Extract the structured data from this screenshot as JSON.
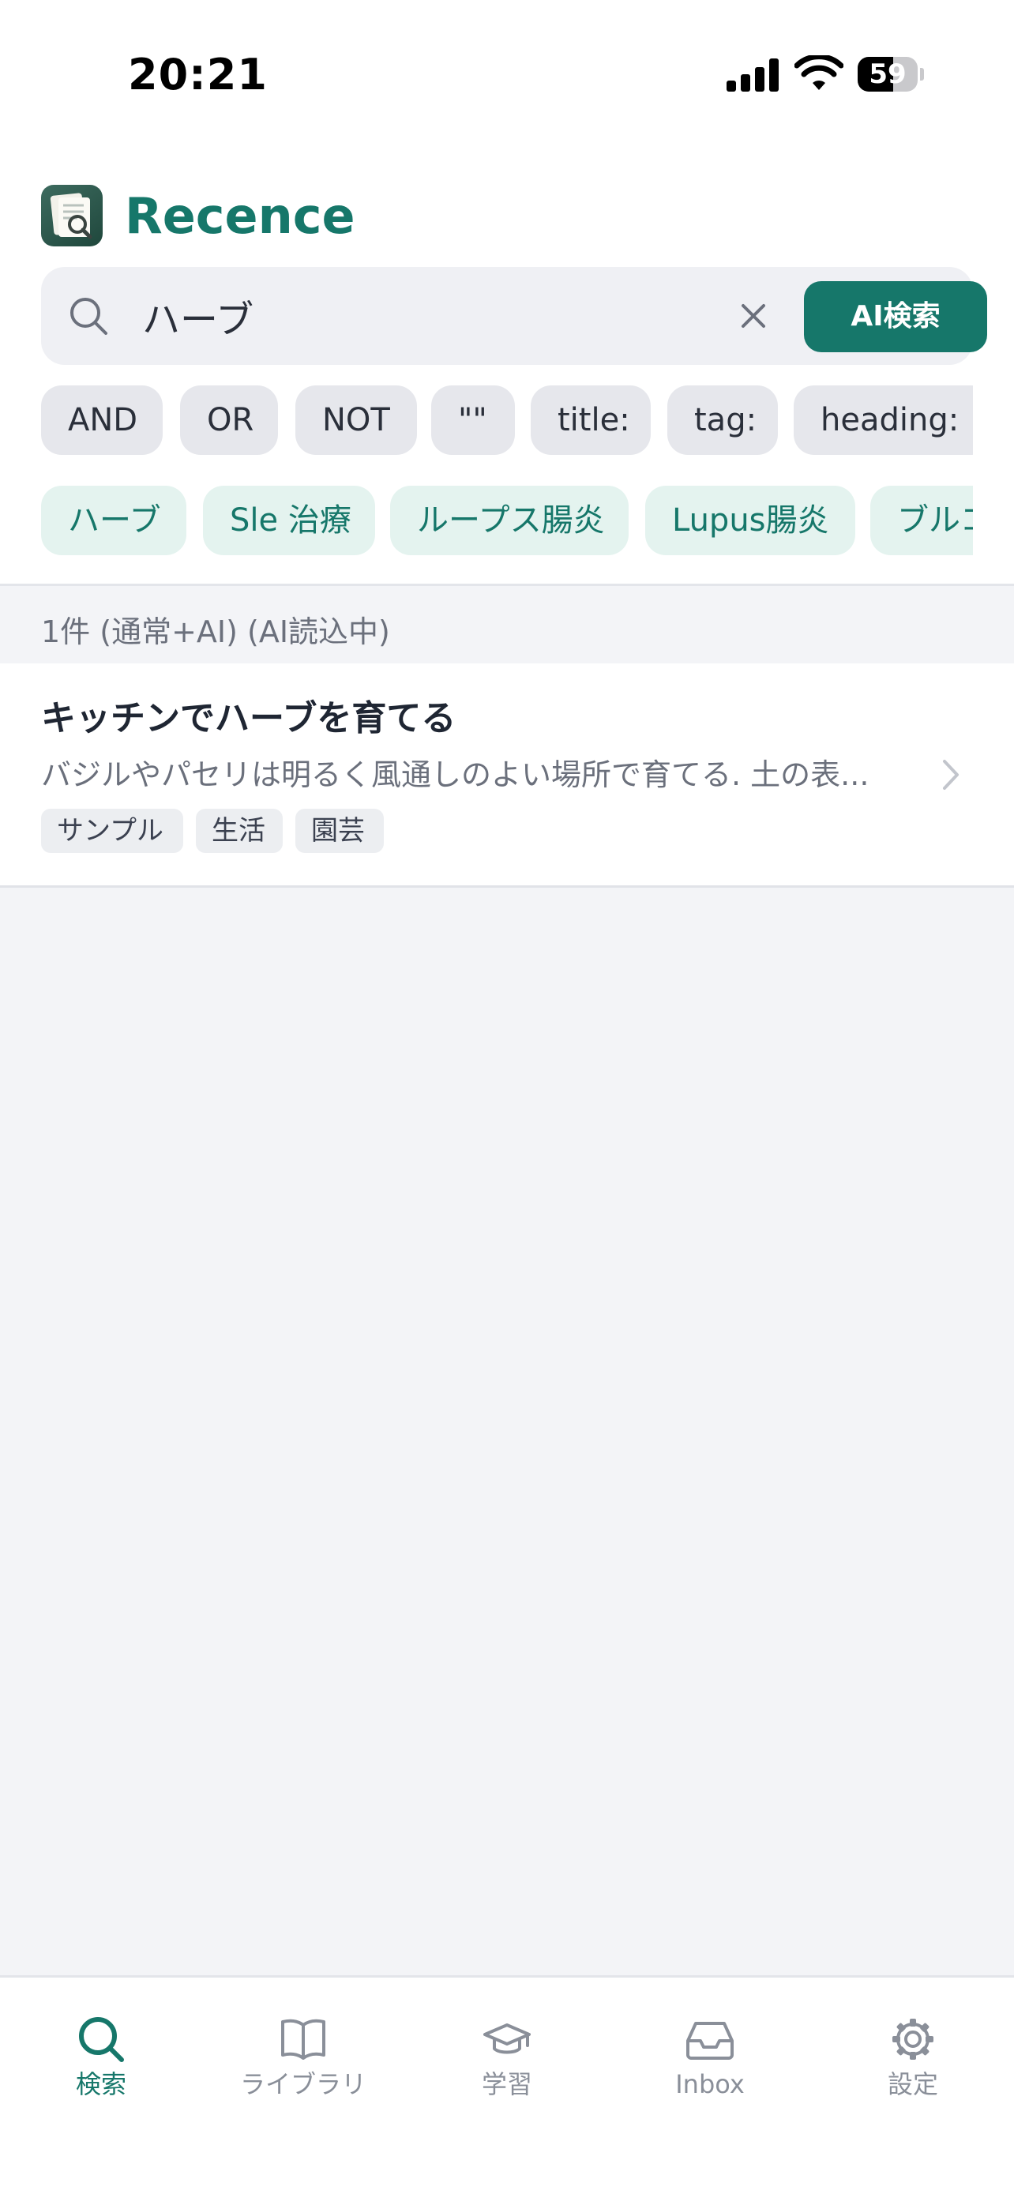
{
  "status_bar": {
    "time": "20:21",
    "battery": "59",
    "battery_level": 0.59
  },
  "header": {
    "title": "Recence",
    "logo_icon": "document-search-icon"
  },
  "search": {
    "query": "ハーブ",
    "ai_button_label": "AI検索",
    "search_icon": "search-icon",
    "clear_icon": "close-icon"
  },
  "operators": [
    "AND",
    "OR",
    "NOT",
    "\"\"",
    "title:",
    "tag:",
    "heading:"
  ],
  "suggestions": [
    "ハーブ",
    "Sle 治療",
    "ループス腸炎",
    "Lupus腸炎",
    "ブルコ"
  ],
  "results": {
    "summary": "1件 (通常+AI) (AI読込中)",
    "items": [
      {
        "title": "キッチンでハーブを育てる",
        "snippet": "バジルやパセリは明るく風通しのよい場所で育てる. 土の表...",
        "tags": [
          "サンプル",
          "生活",
          "園芸"
        ]
      }
    ]
  },
  "tabs": [
    {
      "label": "検索",
      "icon": "search-icon",
      "active": true
    },
    {
      "label": "ライブラリ",
      "icon": "book-icon",
      "active": false
    },
    {
      "label": "学習",
      "icon": "graduation-cap-icon",
      "active": false
    },
    {
      "label": "Inbox",
      "icon": "inbox-icon",
      "active": false
    },
    {
      "label": "設定",
      "icon": "gear-icon",
      "active": false
    }
  ],
  "colors": {
    "accent": "#16776a",
    "suggestion_bg": "#e4f3ef",
    "operator_bg": "#e6e7ec",
    "page_bg": "#f3f4f7",
    "inactive_tab": "#8a8f99"
  }
}
